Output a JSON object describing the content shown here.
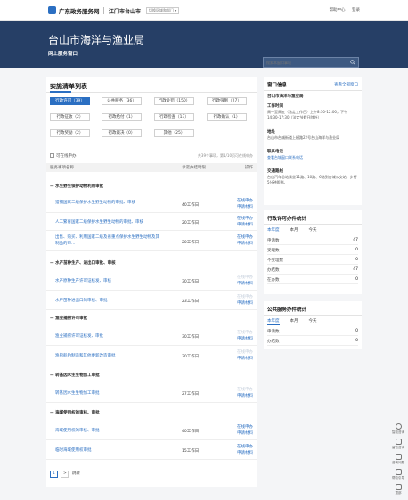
{
  "header": {
    "site_name": "广东政务服务网",
    "city": "江门市台山市",
    "switch_label": "切换区域和部门",
    "nav": [
      "帮助中心",
      "登录"
    ]
  },
  "hero": {
    "title": "台山市海洋与渔业局",
    "subtitle": "网上服务窗口",
    "search_placeholder": "搜索本窗口事项"
  },
  "list": {
    "title": "实施清单列表",
    "categories": [
      {
        "label": "行政许可（39）",
        "active": true
      },
      {
        "label": "公共服务（36）",
        "active": false
      },
      {
        "label": "行政处罚（150）",
        "active": false
      },
      {
        "label": "行政强制（27）",
        "active": false
      },
      {
        "label": "行政征收（2）",
        "active": false
      },
      {
        "label": "行政给付（1）",
        "active": false
      },
      {
        "label": "行政检查（13）",
        "active": false
      },
      {
        "label": "行政确认（1）",
        "active": false
      },
      {
        "label": "行政奖励（2）",
        "active": false
      },
      {
        "label": "行政裁决（0）",
        "active": false
      },
      {
        "label": "其他（25）",
        "active": false
      }
    ],
    "checkbox_label": "可在线申办",
    "total_text": "共39个事项，第1/10页可在线申办",
    "columns": {
      "name": "服务事项名称",
      "days": "承诺办结时限",
      "op": "操作"
    },
    "groups": [
      {
        "title": "水生野生保护动物利用审批",
        "rows": [
          {
            "name": "猎捕国家二级保护水生野生动物的审批、审核",
            "days": "40工作日",
            "op1": "在线申办",
            "op2": "申请材料"
          },
          {
            "name": "人工繁育国家二级保护水生野生动物的审批、审核",
            "days": "20工作日",
            "op1": "在线申办",
            "op2": "申请材料"
          },
          {
            "name": "出售、购买、利用国家二级及省重点保护水生野生动物及其制品的审…",
            "days": "20工作日",
            "op1": "在线申办",
            "op2": "申请材料"
          }
        ]
      },
      {
        "title": "水产苗种生产、进出口审批、审核",
        "rows": [
          {
            "name": "水产原种生产许可证核发、审核",
            "days": "30工作日",
            "op1": "在线申办",
            "op2": "申请材料"
          },
          {
            "name": "水产苗种进出口的审核、审批",
            "days": "23工作日",
            "op1": "在线申办",
            "op2": "申请材料"
          }
        ]
      },
      {
        "title": "渔业捕捞许可审批",
        "rows": [
          {
            "name": "渔业捕捞许可证核发、审批",
            "days": "30工作日",
            "op1": "在线申办",
            "op2": "申请材料"
          },
          {
            "name": "渔船船舶制造和其他更新改造审批",
            "days": "30工作日",
            "op1": "在线申办",
            "op2": "申请材料"
          }
        ]
      },
      {
        "title": "转基因水生生物加工审批",
        "rows": [
          {
            "name": "转基因水生生物加工审批",
            "days": "27工作日",
            "op1": "在线申办",
            "op2": "申请材料"
          }
        ]
      },
      {
        "title": "海域使用权的审核、审批",
        "rows": [
          {
            "name": "海域使用权的审核、审批",
            "days": "40工作日",
            "op1": "在线申办",
            "op2": "申请材料"
          },
          {
            "name": "临时海域使用权审批",
            "days": "15工作日",
            "op1": "在线申办",
            "op2": "申请材料"
          }
        ]
      }
    ],
    "pager": {
      "page": "1",
      "next": "跳转",
      "go": ">"
    }
  },
  "window_info": {
    "title": "窗口信息",
    "more": "查看全部窗口",
    "name": "台山市海洋与渔业局",
    "hours_label": "工作时间",
    "hours": "周一至周五（法定工作日）上午8:30-12:00，下午14:30-17:30（法定节假日除外）",
    "address_label": "地址",
    "address": "台山市台城街道上横路22号台山海洋与渔业局",
    "phone_label": "联系电话",
    "phone": "查看台城窗口联系电话",
    "route_label": "交通路线",
    "route": "台山汽车总站乘坐11路、10路、6路到台城公交站，步行5分钟即到。"
  },
  "permit_stats": {
    "title": "行政许可办件统计",
    "tabs": [
      "本年度",
      "本月",
      "今天"
    ],
    "rows": [
      {
        "label": "申请数",
        "value": "47"
      },
      {
        "label": "受理数",
        "value": "0"
      },
      {
        "label": "不受理数",
        "value": "0"
      },
      {
        "label": "办结数",
        "value": "47"
      },
      {
        "label": "在办数",
        "value": "0"
      }
    ]
  },
  "service_stats": {
    "title": "公共服务办件统计",
    "tabs": [
      "本年度",
      "本月",
      "今天"
    ],
    "rows": [
      {
        "label": "申请数",
        "value": "0"
      },
      {
        "label": "办结数",
        "value": "0"
      }
    ]
  },
  "float_bar": [
    {
      "icon": "headset-icon",
      "label": "智能咨询"
    },
    {
      "icon": "speech-icon",
      "label": "留言咨询"
    },
    {
      "icon": "feedback-icon",
      "label": "咨询问题"
    },
    {
      "icon": "help-icon",
      "label": "帮助引导"
    },
    {
      "icon": "top-icon",
      "label": "顶部"
    }
  ],
  "colors": {
    "accent": "#2b6fc2",
    "hero_bg": "#263f66"
  }
}
